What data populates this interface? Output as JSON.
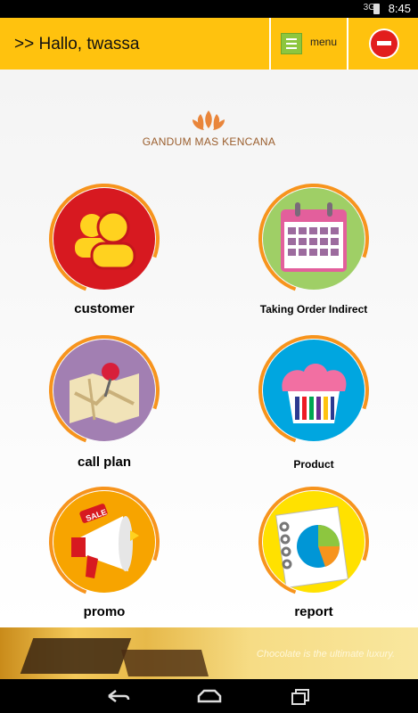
{
  "status_bar": {
    "signal": "3G",
    "time": "8:45"
  },
  "header": {
    "greeting": ">> Hallo, twassa",
    "menu_label": "menu",
    "brand_color": "#ffc20e"
  },
  "logo": {
    "text": "GANDUM MAS KENCANA"
  },
  "tiles": [
    {
      "label": "customer",
      "icon": "users-icon",
      "bg": "#d71920"
    },
    {
      "label": "Taking Order Indirect",
      "icon": "calendar-icon",
      "bg": "#9fcf66"
    },
    {
      "label": "call plan",
      "icon": "map-pin-icon",
      "bg": "#a27fb2"
    },
    {
      "label": "Product",
      "icon": "cupcake-icon",
      "bg": "#00a6e0"
    },
    {
      "label": "promo",
      "icon": "megaphone-icon",
      "bg": "#f7a400"
    },
    {
      "label": "report",
      "icon": "report-chart-icon",
      "bg": "#ffe100"
    }
  ],
  "banner": {
    "text": "Chocolate is the ultimate luxury."
  },
  "nav": {
    "back": "back-icon",
    "home": "home-icon",
    "recents": "recents-icon"
  }
}
